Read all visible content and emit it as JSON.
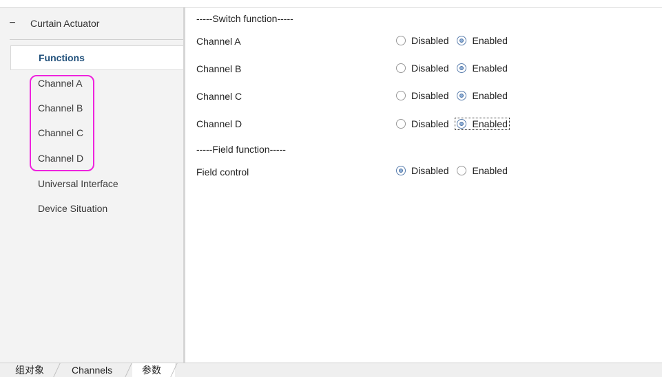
{
  "tree": {
    "collapse_symbol": "−",
    "root_label": "Curtain Actuator",
    "items": [
      {
        "label": "Functions",
        "active": true
      },
      {
        "label": "Channel A"
      },
      {
        "label": "Channel B"
      },
      {
        "label": "Channel C"
      },
      {
        "label": "Channel D"
      },
      {
        "label": "Universal Interface"
      },
      {
        "label": "Device Situation"
      }
    ]
  },
  "params": {
    "switch_section": "-----Switch function-----",
    "field_section": "-----Field function-----",
    "option_disabled": "Disabled",
    "option_enabled": "Enabled",
    "rows": [
      {
        "label": "Channel A",
        "selected": "Enabled"
      },
      {
        "label": "Channel B",
        "selected": "Enabled"
      },
      {
        "label": "Channel C",
        "selected": "Enabled"
      },
      {
        "label": "Channel D",
        "selected": "Enabled",
        "focused": true
      },
      {
        "label": "Field control",
        "selected": "Disabled"
      }
    ]
  },
  "bottom_tabs": [
    {
      "label": "组对象"
    },
    {
      "label": "Channels"
    },
    {
      "label": "参数",
      "active": true
    }
  ],
  "colors": {
    "highlight": "#ee22dd",
    "active_text": "#1f4f7a"
  }
}
